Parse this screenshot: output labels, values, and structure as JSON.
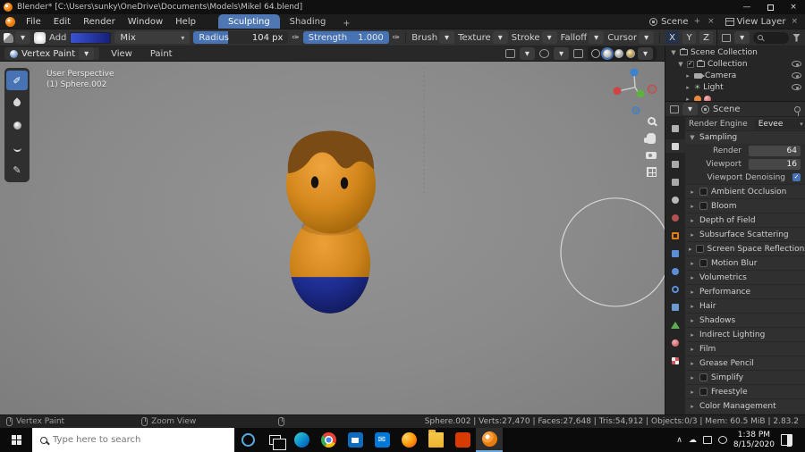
{
  "titlebar": {
    "title": "Blender* [C:\\Users\\sunky\\OneDrive\\Documents\\Models\\Mikel 64.blend]"
  },
  "menubar": {
    "items": [
      "File",
      "Edit",
      "Render",
      "Window",
      "Help"
    ],
    "workspaces": [
      "Sculpting",
      "Shading"
    ],
    "add_tab": "+",
    "scene_label": "Scene",
    "view_layer_label": "View Layer"
  },
  "tool_settings": {
    "brush_name": "Add",
    "blend_mode": "Mix",
    "radius_label": "Radius",
    "radius_value": "104 px",
    "strength_label": "Strength",
    "strength_value": "1.000",
    "panels": [
      "Brush",
      "Texture",
      "Stroke",
      "Falloff",
      "Cursor"
    ],
    "symmetry": [
      "X",
      "Y",
      "Z"
    ]
  },
  "viewport": {
    "mode": "Vertex Paint",
    "menus": [
      "View",
      "Paint"
    ],
    "overlay_line1": "User Perspective",
    "overlay_line2": "(1) Sphere.002"
  },
  "outliner": {
    "rows": [
      {
        "label": "Scene Collection"
      },
      {
        "label": "Collection"
      },
      {
        "label": "Camera"
      },
      {
        "label": "Light"
      }
    ]
  },
  "properties": {
    "breadcrumb": "Scene",
    "render_engine_label": "Render Engine",
    "render_engine_value": "Eevee",
    "sampling_title": "Sampling",
    "render_label": "Render",
    "render_value": "64",
    "viewport_label": "Viewport",
    "viewport_value": "16",
    "denoising_label": "Viewport Denoising",
    "sections": [
      {
        "label": "Ambient Occlusion",
        "checkbox": true
      },
      {
        "label": "Bloom",
        "checkbox": true
      },
      {
        "label": "Depth of Field",
        "checkbox": false
      },
      {
        "label": "Subsurface Scattering",
        "checkbox": false
      },
      {
        "label": "Screen Space Reflections",
        "checkbox": true
      },
      {
        "label": "Motion Blur",
        "checkbox": true
      },
      {
        "label": "Volumetrics",
        "checkbox": false
      },
      {
        "label": "Performance",
        "checkbox": false
      },
      {
        "label": "Hair",
        "checkbox": false
      },
      {
        "label": "Shadows",
        "checkbox": false
      },
      {
        "label": "Indirect Lighting",
        "checkbox": false
      },
      {
        "label": "Film",
        "checkbox": false
      },
      {
        "label": "Grease Pencil",
        "checkbox": false
      },
      {
        "label": "Simplify",
        "checkbox": true
      },
      {
        "label": "Freestyle",
        "checkbox": true
      },
      {
        "label": "Color Management",
        "checkbox": false
      }
    ]
  },
  "statusbar": {
    "hint1": "Vertex Paint",
    "hint2": "Zoom View",
    "stats": "Sphere.002 | Verts:27,470 | Faces:27,648 | Tris:54,912 | Objects:0/3 | Mem: 60.5 MiB | 2.83.2"
  },
  "taskbar": {
    "search_placeholder": "Type here to search",
    "time": "1:38 PM",
    "date": "8/15/2020"
  },
  "icons": {
    "arrow_down": "▾",
    "arrow_right": "▸",
    "arrow_down_big": "▼",
    "check": "✓",
    "close": "×",
    "minimize": "—",
    "pressure_pen": "✑",
    "light": "☀",
    "draw_tool": "✐",
    "annotate_tool": "✎",
    "chevron_up": "∧",
    "cloud": "☁",
    "envelope": "✉"
  },
  "colors": {
    "accent_blue": "#4772b3",
    "vertex_paint_color": "#2336a8",
    "character_skin": "#d98a1f",
    "character_hair": "#7a4b15",
    "character_pants": "#1b2f8e"
  }
}
